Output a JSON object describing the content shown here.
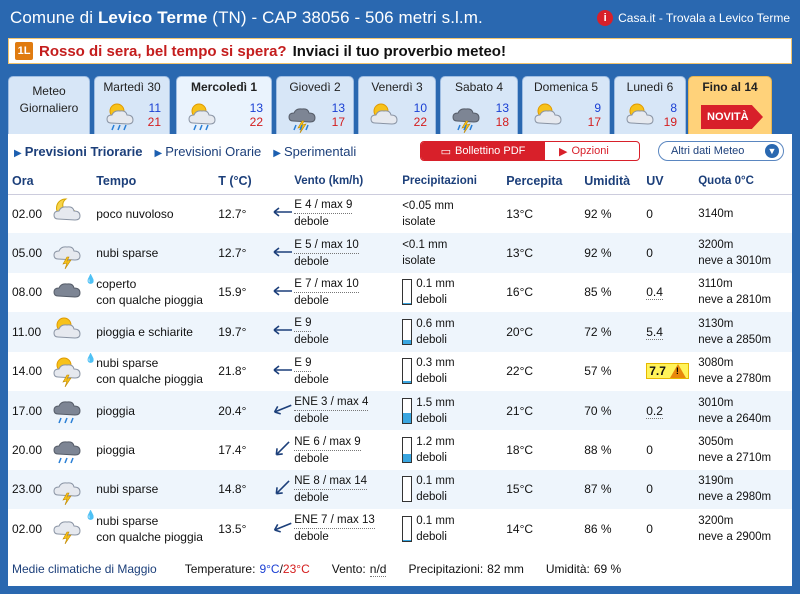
{
  "header": {
    "title_prefix": "Comune di ",
    "title_city": "Levico Terme",
    "title_suffix": " (TN) - CAP 38056 - 506 metri s.l.m.",
    "casa_icon": "i",
    "casa_text": "Casa.it - Trovala a Levico Terme"
  },
  "proverb": {
    "icon": "1L",
    "red": "Rosso di sera, bel tempo si spera?",
    "black": "Inviaci il tuo proverbio meteo!"
  },
  "tabs": {
    "meteo_label_1": "Meteo",
    "meteo_label_2": "Giornaliero",
    "days": [
      {
        "label": "Martedì 30",
        "icon": "partly-cloudy-rain",
        "tmin": "11",
        "tmax": "21"
      },
      {
        "label": "Mercoledì 1",
        "icon": "partly-cloudy-rain",
        "tmin": "13",
        "tmax": "22"
      },
      {
        "label": "Giovedì 2",
        "icon": "storm",
        "tmin": "13",
        "tmax": "17"
      },
      {
        "label": "Venerdì 3",
        "icon": "partly-cloudy",
        "tmin": "10",
        "tmax": "22"
      },
      {
        "label": "Sabato 4",
        "icon": "storm",
        "tmin": "13",
        "tmax": "18"
      },
      {
        "label": "Domenica 5",
        "icon": "partly-cloudy",
        "tmin": "9",
        "tmax": "17"
      },
      {
        "label": "Lunedì 6",
        "icon": "partly-cloudy",
        "tmin": "8",
        "tmax": "19"
      }
    ],
    "fino_label": "Fino al 14",
    "novita": "NOVITÀ"
  },
  "subnav": {
    "triorarie": "Previsioni Triorarie",
    "orarie": "Previsioni Orarie",
    "sperimentali": "Sperimentali",
    "pdf": "Bollettino PDF",
    "opzioni": "Opzioni",
    "altri": "Altri dati Meteo"
  },
  "columns": {
    "ora": "Ora",
    "tempo": "Tempo",
    "t": "T (°C)",
    "vento": "Vento (km/h)",
    "prec": "Precipitazioni",
    "perc": "Percepita",
    "umid": "Umidità",
    "uv": "UV",
    "quota": "Quota 0°C"
  },
  "rows": [
    {
      "ora": "02.00",
      "icon": "moon-cloud",
      "tempo1": "poco nuvoloso",
      "tempo2": "",
      "t": "12.7°",
      "dir": "E",
      "v1": "E 4 / max 9",
      "v2": "debole",
      "p1": "<0.05 mm",
      "p2": "isolate",
      "pfill": 0,
      "perc": "13°C",
      "umid": "92 %",
      "uv": "0",
      "q1": "3140m",
      "q2": ""
    },
    {
      "ora": "05.00",
      "icon": "cloud-lightning",
      "tempo1": "nubi sparse",
      "tempo2": "",
      "t": "12.7°",
      "dir": "E",
      "v1": "E 5 / max 10",
      "v2": "debole",
      "p1": "<0.1 mm",
      "p2": "isolate",
      "pfill": 0,
      "perc": "13°C",
      "umid": "92 %",
      "uv": "0",
      "q1": "3200m",
      "q2": "neve a 3010m"
    },
    {
      "ora": "08.00",
      "icon": "overcast",
      "tempo1": "coperto",
      "tempo2": "con qualche pioggia",
      "t": "15.9°",
      "dir": "E",
      "v1": "E 7 / max 10",
      "v2": "debole",
      "p1": "0.1 mm",
      "p2": "deboli",
      "pfill": 0.05,
      "perc": "16°C",
      "umid": "85 %",
      "uv": "0.4",
      "q1": "3110m",
      "q2": "neve a 2810m"
    },
    {
      "ora": "11.00",
      "icon": "sun-cloud",
      "tempo1": "pioggia e schiarite",
      "tempo2": "",
      "t": "19.7°",
      "dir": "E",
      "v1": "E 9",
      "v2": "debole",
      "p1": "0.6 mm",
      "p2": "deboli",
      "pfill": 0.15,
      "perc": "20°C",
      "umid": "72 %",
      "uv": "5.4",
      "q1": "3130m",
      "q2": "neve a 2850m"
    },
    {
      "ora": "14.00",
      "icon": "sun-storm",
      "tempo1": "nubi sparse",
      "tempo2": "con qualche pioggia",
      "t": "21.8°",
      "dir": "E",
      "v1": "E 9",
      "v2": "debole",
      "p1": "0.3 mm",
      "p2": "deboli",
      "pfill": 0.1,
      "perc": "22°C",
      "umid": "57 %",
      "uv": "7.7",
      "q1": "3080m",
      "q2": "neve a 2780m"
    },
    {
      "ora": "17.00",
      "icon": "rain",
      "tempo1": "pioggia",
      "tempo2": "",
      "t": "20.4°",
      "dir": "ENE",
      "v1": "ENE 3 / max 4",
      "v2": "debole",
      "p1": "1.5 mm",
      "p2": "deboli",
      "pfill": 0.4,
      "perc": "21°C",
      "umid": "70 %",
      "uv": "0.2",
      "q1": "3010m",
      "q2": "neve a 2640m"
    },
    {
      "ora": "20.00",
      "icon": "rain",
      "tempo1": "pioggia",
      "tempo2": "",
      "t": "17.4°",
      "dir": "NE",
      "v1": "NE 6 / max 9",
      "v2": "debole",
      "p1": "1.2 mm",
      "p2": "deboli",
      "pfill": 0.33,
      "perc": "18°C",
      "umid": "88 %",
      "uv": "0",
      "q1": "3050m",
      "q2": "neve a 2710m"
    },
    {
      "ora": "23.00",
      "icon": "cloud-lightning",
      "tempo1": "nubi sparse",
      "tempo2": "",
      "t": "14.8°",
      "dir": "NE",
      "v1": "NE 8 / max 14",
      "v2": "debole",
      "p1": "0.1 mm",
      "p2": "deboli",
      "pfill": 0,
      "perc": "15°C",
      "umid": "87 %",
      "uv": "0",
      "q1": "3190m",
      "q2": "neve a 2980m"
    },
    {
      "ora": "02.00",
      "icon": "cloud-lightning",
      "tempo1": "nubi sparse",
      "tempo2": "con qualche pioggia",
      "t": "13.5°",
      "dir": "ENE",
      "v1": "ENE 7 / max 13",
      "v2": "debole",
      "p1": "0.1 mm",
      "p2": "deboli",
      "pfill": 0.05,
      "perc": "14°C",
      "umid": "86 %",
      "uv": "0",
      "q1": "3200m",
      "q2": "neve a 2900m"
    }
  ],
  "footer": {
    "medie": "Medie climatiche di Maggio",
    "temp_label": "Temperature:",
    "tmin": "9°C",
    "slash": "/",
    "tmax": "23°C",
    "vento_label": "Vento:",
    "vento_val": "n/d",
    "prec_label": "Precipitazioni:",
    "prec_val": "82 mm",
    "umid_label": "Umidità:",
    "umid_val": "69 %"
  },
  "colors": {
    "bg": "#2a68b0",
    "accent_red": "#d8202a",
    "tmin_blue": "#1a3fd3",
    "tmax_red": "#d41d1d"
  }
}
